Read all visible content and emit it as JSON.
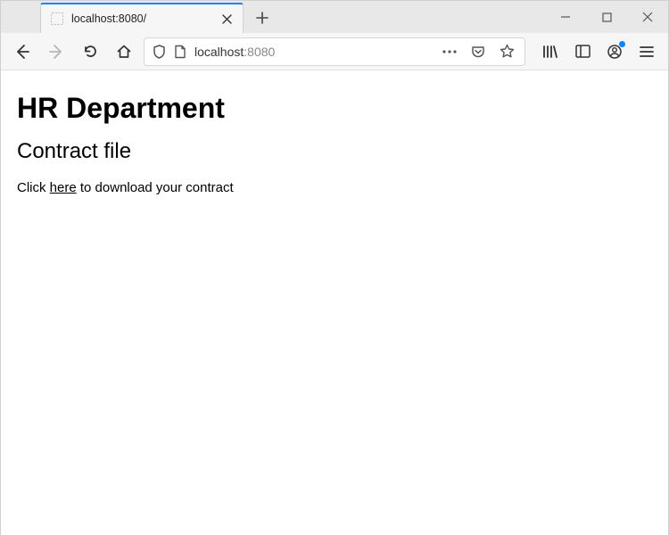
{
  "tab": {
    "title": "localhost:8080/"
  },
  "url": {
    "host": "localhost",
    "port": ":8080"
  },
  "page": {
    "h1": "HR Department",
    "h2": "Contract file",
    "p_before": "Click ",
    "p_link": "here",
    "p_after": " to download your contract"
  }
}
